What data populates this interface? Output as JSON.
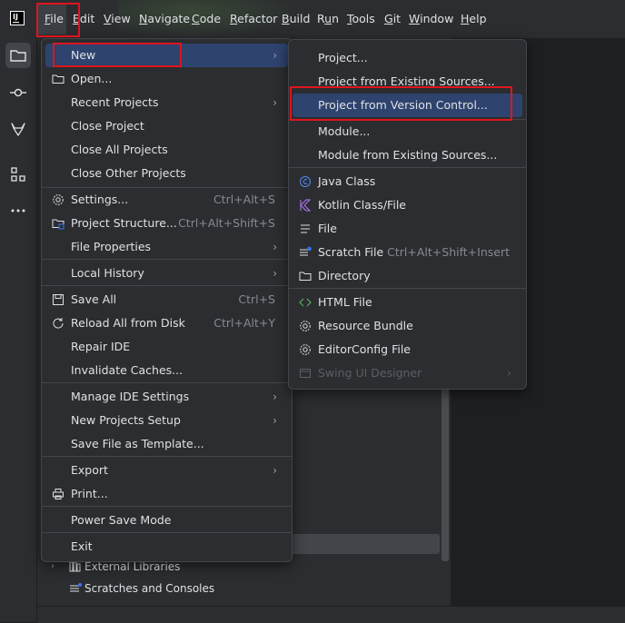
{
  "menubar": {
    "items": [
      {
        "label": "File",
        "mnemonic": "F",
        "rest": "ile"
      },
      {
        "label": "Edit",
        "mnemonic": "E",
        "rest": "dit"
      },
      {
        "label": "View",
        "mnemonic": "V",
        "rest": "iew"
      },
      {
        "label": "Navigate",
        "mnemonic": "N",
        "rest": "avigate"
      },
      {
        "label": "Code",
        "mnemonic": "C",
        "rest": "ode"
      },
      {
        "label": "Refactor",
        "mnemonic": "R",
        "rest": "efactor"
      },
      {
        "label": "Build",
        "mnemonic": "B",
        "rest": "uild"
      },
      {
        "label": "Run",
        "mnemonic": "R",
        "rest": "un",
        "pre": "R",
        "u": "u",
        "post": "n"
      },
      {
        "label": "Tools",
        "mnemonic": "T",
        "rest": "ools"
      },
      {
        "label": "Git",
        "mnemonic": "G",
        "rest": "it"
      },
      {
        "label": "Window",
        "mnemonic": "W",
        "rest": "indow"
      },
      {
        "label": "Help",
        "mnemonic": "H",
        "rest": "elp"
      }
    ],
    "logo_text": "IJ"
  },
  "file_menu": {
    "items": [
      {
        "label": "New",
        "arrow": "›"
      },
      {
        "label": "Open...",
        "icon": "folder-icon"
      },
      {
        "label": "Recent Projects",
        "arrow": "›"
      },
      {
        "label": "Close Project"
      },
      {
        "label": "Close All Projects"
      },
      {
        "label": "Close Other Projects"
      },
      {
        "label": "Settings...",
        "shortcut": "Ctrl+Alt+S",
        "icon": "gear-icon"
      },
      {
        "label": "Project Structure...",
        "shortcut": "Ctrl+Alt+Shift+S",
        "icon": "project-structure-icon"
      },
      {
        "label": "File Properties",
        "arrow": "›"
      },
      {
        "label": "Local History",
        "arrow": "›"
      },
      {
        "label": "Save All",
        "shortcut": "Ctrl+S",
        "icon": "save-icon"
      },
      {
        "label": "Reload All from Disk",
        "shortcut": "Ctrl+Alt+Y",
        "icon": "reload-icon"
      },
      {
        "label": "Repair IDE"
      },
      {
        "label": "Invalidate Caches..."
      },
      {
        "label": "Manage IDE Settings",
        "arrow": "›"
      },
      {
        "label": "New Projects Setup",
        "arrow": "›"
      },
      {
        "label": "Save File as Template..."
      },
      {
        "label": "Export",
        "arrow": "›"
      },
      {
        "label": "Print...",
        "icon": "print-icon"
      },
      {
        "label": "Power Save Mode"
      },
      {
        "label": "Exit"
      }
    ]
  },
  "new_submenu": {
    "items": [
      {
        "label": "Project..."
      },
      {
        "label": "Project from Existing Sources..."
      },
      {
        "label": "Project from Version Control..."
      },
      {
        "label": "Module..."
      },
      {
        "label": "Module from Existing Sources..."
      },
      {
        "label": "Java Class",
        "icon": "java-class-icon"
      },
      {
        "label": "Kotlin Class/File",
        "icon": "kotlin-icon"
      },
      {
        "label": "File",
        "icon": "file-icon"
      },
      {
        "label": "Scratch File",
        "shortcut": "Ctrl+Alt+Shift+Insert",
        "icon": "scratch-file-icon"
      },
      {
        "label": "Directory",
        "icon": "folder-icon"
      },
      {
        "label": "HTML File",
        "icon": "html-icon"
      },
      {
        "label": "Resource Bundle",
        "icon": "resource-bundle-icon"
      },
      {
        "label": "EditorConfig File",
        "icon": "editorconfig-icon"
      },
      {
        "label": "Swing UI Designer",
        "arrow": "›",
        "icon": "swing-icon"
      }
    ]
  },
  "project_tree": {
    "rows": [
      {
        "label": "External Libraries",
        "chevron": "›"
      },
      {
        "label": "Scratches and Consoles"
      }
    ]
  }
}
